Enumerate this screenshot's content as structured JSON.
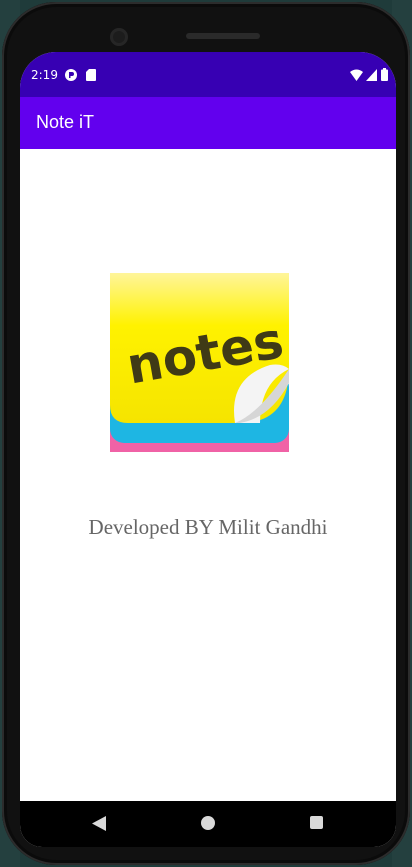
{
  "status_bar": {
    "time": "2:19"
  },
  "app_bar": {
    "title": "Note iT"
  },
  "logo": {
    "text": "notes"
  },
  "content": {
    "credit": "Developed BY Milit Gandhi"
  },
  "colors": {
    "status_bar": "#3700b3",
    "app_bar": "#6200ee",
    "credit_text": "#666666"
  },
  "icons": [
    "notification-icon",
    "sd-card-icon",
    "wifi-icon",
    "signal-icon",
    "battery-icon",
    "back-icon",
    "home-icon",
    "recents-icon"
  ]
}
